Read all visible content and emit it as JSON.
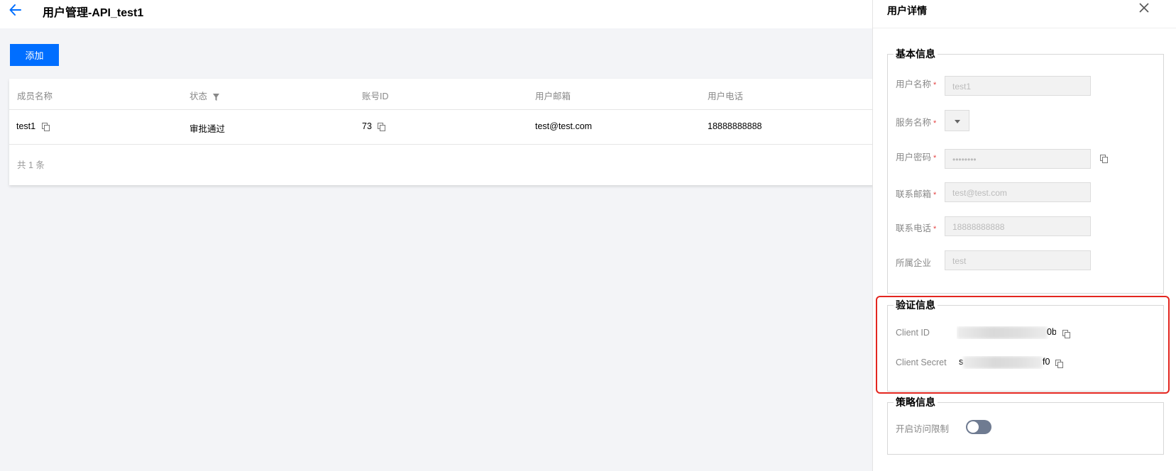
{
  "header": {
    "title": "用户管理-API_test1"
  },
  "toolbar": {
    "add_label": "添加"
  },
  "table": {
    "columns": [
      "成员名称",
      "状态",
      "账号ID",
      "用户邮箱",
      "用户电话"
    ],
    "rows": [
      {
        "name": "test1",
        "status": "审批通过",
        "account_id": "73",
        "email": "test@test.com",
        "phone": "18888888888"
      }
    ],
    "total": "共 1 条"
  },
  "drawer": {
    "title": "用户详情",
    "basic": {
      "legend": "基本信息",
      "username_label": "用户名称",
      "username_value": "test1",
      "service_label": "服务名称",
      "password_label": "用户密码",
      "password_value": "••••••••",
      "email_label": "联系邮箱",
      "email_value": "test@test.com",
      "phone_label": "联系电话",
      "phone_value": "18888888888",
      "company_label": "所属企业",
      "company_value": "test"
    },
    "auth": {
      "legend": "验证信息",
      "client_id_label": "Client ID",
      "client_id_suffix": "0b",
      "client_secret_label": "Client Secret",
      "client_secret_prefix": "s",
      "client_secret_suffix": "f0"
    },
    "policy": {
      "legend": "策略信息",
      "access_limit_label": "开启访问限制",
      "access_limit_enabled": false
    }
  },
  "colors": {
    "primary": "#006eff",
    "highlight": "#e3261f",
    "required": "#e54545",
    "toggle_off": "#6f7b91"
  }
}
